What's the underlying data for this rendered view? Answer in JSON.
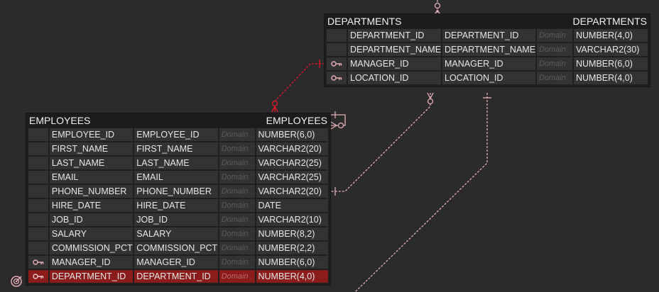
{
  "departments": {
    "title_left": "DEPARTMENTS",
    "title_right": "DEPARTMENTS",
    "domain_placeholder": "Domain",
    "columns": [
      {
        "name": "DEPARTMENT_ID",
        "logical": "DEPARTMENT_ID",
        "type": "NUMBER(4,0)",
        "key": false
      },
      {
        "name": "DEPARTMENT_NAME",
        "logical": "DEPARTMENT_NAME",
        "type": "VARCHAR2(30)",
        "key": false
      },
      {
        "name": "MANAGER_ID",
        "logical": "MANAGER_ID",
        "type": "NUMBER(6,0)",
        "key": true
      },
      {
        "name": "LOCATION_ID",
        "logical": "LOCATION_ID",
        "type": "NUMBER(4,0)",
        "key": true
      }
    ]
  },
  "employees": {
    "title_left": "EMPLOYEES",
    "title_right": "EMPLOYEES",
    "domain_placeholder": "Domain",
    "columns": [
      {
        "name": "EMPLOYEE_ID",
        "logical": "EMPLOYEE_ID",
        "type": "NUMBER(6,0)",
        "key": false
      },
      {
        "name": "FIRST_NAME",
        "logical": "FIRST_NAME",
        "type": "VARCHAR2(20)",
        "key": false
      },
      {
        "name": "LAST_NAME",
        "logical": "LAST_NAME",
        "type": "VARCHAR2(25)",
        "key": false
      },
      {
        "name": "EMAIL",
        "logical": "EMAIL",
        "type": "VARCHAR2(25)",
        "key": false
      },
      {
        "name": "PHONE_NUMBER",
        "logical": "PHONE_NUMBER",
        "type": "VARCHAR2(20)",
        "key": false
      },
      {
        "name": "HIRE_DATE",
        "logical": "HIRE_DATE",
        "type": "DATE",
        "key": false
      },
      {
        "name": "JOB_ID",
        "logical": "JOB_ID",
        "type": "VARCHAR2(10)",
        "key": false
      },
      {
        "name": "SALARY",
        "logical": "SALARY",
        "type": "NUMBER(8,2)",
        "key": false
      },
      {
        "name": "COMMISSION_PCT",
        "logical": "COMMISSION_PCT",
        "type": "NUMBER(2,2)",
        "key": false
      },
      {
        "name": "MANAGER_ID",
        "logical": "MANAGER_ID",
        "type": "NUMBER(6,0)",
        "key": true
      },
      {
        "name": "DEPARTMENT_ID",
        "logical": "DEPARTMENT_ID",
        "type": "NUMBER(4,0)",
        "key": true,
        "highlighted": true
      }
    ]
  },
  "icons": {
    "key": "key-icon",
    "target": "target-icon"
  },
  "colors": {
    "background": "#2b2b2c",
    "relation_selected": "#e0182a",
    "relation_normal": "#e3aeb4",
    "row_highlight": "#8a1c1c"
  }
}
